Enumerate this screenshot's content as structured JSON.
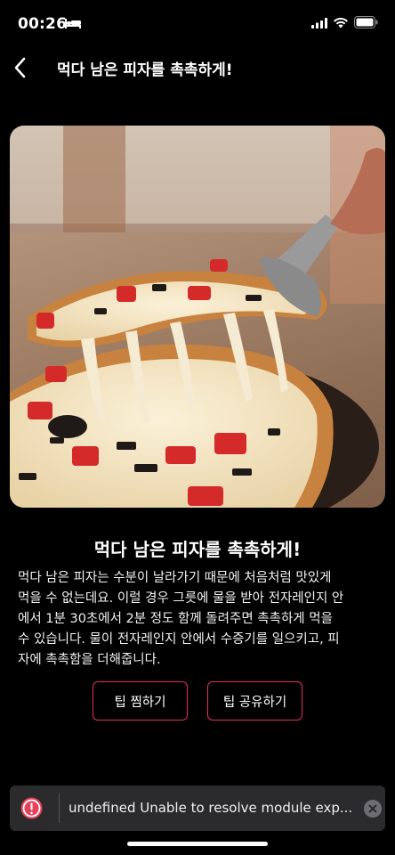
{
  "status_bar": {
    "time": "00:26",
    "icons": [
      "bed-icon",
      "signal-icon",
      "wifi-icon",
      "battery-icon"
    ]
  },
  "nav": {
    "back_icon": "chevron-left-icon",
    "title": "먹다 남은 피자를 촉촉하게!"
  },
  "hero_image": {
    "subject": "pizza-slice-photo"
  },
  "tip": {
    "title": "먹다 남은 피자를 촉촉하게!",
    "body_lines": [
      "먹다 남은 피자는 수분이 날라가기 때문에 처음처럼 맛있게",
      "먹을 수 없는데요. 이럴 경우 그릇에 물을 받아 전자레인지 안",
      "에서 1분 30초에서 2분 정도 함께 돌려주면 촉촉하게 먹을",
      "수 있습니다. 물이 전자레인지 안에서 수증기를 일으키고, 피",
      "자에 촉촉함을 더해줍니다."
    ]
  },
  "actions": {
    "save_label": "팁 찜하기",
    "share_label": "팁 공유하기",
    "accent_color": "#e8286f"
  },
  "toast": {
    "message": "undefined Unable to resolve module exp...",
    "error_color": "#e8425a",
    "icon": "error-icon",
    "close_icon": "close-icon"
  }
}
